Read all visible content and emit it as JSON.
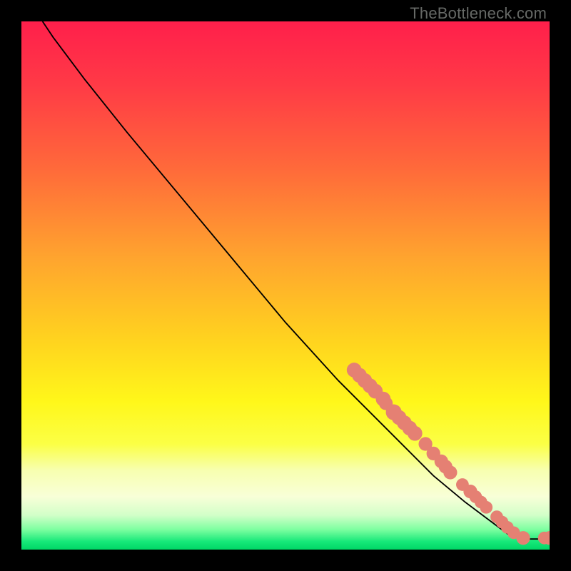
{
  "watermark": "TheBottleneck.com",
  "gradient": {
    "stops": [
      {
        "offset": 0.0,
        "color": "#ff1f4b"
      },
      {
        "offset": 0.12,
        "color": "#ff3a46"
      },
      {
        "offset": 0.28,
        "color": "#ff6a3a"
      },
      {
        "offset": 0.45,
        "color": "#ffa52e"
      },
      {
        "offset": 0.6,
        "color": "#ffd21f"
      },
      {
        "offset": 0.72,
        "color": "#fff71a"
      },
      {
        "offset": 0.8,
        "color": "#fbff45"
      },
      {
        "offset": 0.85,
        "color": "#f7ffb0"
      },
      {
        "offset": 0.9,
        "color": "#f8ffd8"
      },
      {
        "offset": 0.935,
        "color": "#d2ffc8"
      },
      {
        "offset": 0.962,
        "color": "#7dffa0"
      },
      {
        "offset": 0.985,
        "color": "#16e879"
      },
      {
        "offset": 1.0,
        "color": "#00d666"
      }
    ]
  },
  "chart_data": {
    "type": "line",
    "title": "",
    "xlabel": "",
    "ylabel": "",
    "xlim": [
      0,
      100
    ],
    "ylim": [
      0,
      100
    ],
    "series": [
      {
        "name": "curve",
        "points": [
          {
            "x": 4,
            "y": 100
          },
          {
            "x": 6,
            "y": 97
          },
          {
            "x": 9,
            "y": 93
          },
          {
            "x": 12,
            "y": 89
          },
          {
            "x": 20,
            "y": 79
          },
          {
            "x": 30,
            "y": 67
          },
          {
            "x": 40,
            "y": 55
          },
          {
            "x": 50,
            "y": 43
          },
          {
            "x": 60,
            "y": 32
          },
          {
            "x": 70,
            "y": 22
          },
          {
            "x": 78,
            "y": 14
          },
          {
            "x": 84,
            "y": 9
          },
          {
            "x": 88,
            "y": 6
          },
          {
            "x": 92,
            "y": 3
          },
          {
            "x": 95,
            "y": 2
          },
          {
            "x": 100,
            "y": 2
          }
        ]
      }
    ],
    "markers": [
      {
        "x": 63,
        "y": 34,
        "r": 1.4
      },
      {
        "x": 64,
        "y": 33,
        "r": 1.4
      },
      {
        "x": 65,
        "y": 32,
        "r": 1.4
      },
      {
        "x": 66,
        "y": 31,
        "r": 1.4
      },
      {
        "x": 67,
        "y": 30,
        "r": 1.4
      },
      {
        "x": 68.5,
        "y": 28.5,
        "r": 1.4
      },
      {
        "x": 69,
        "y": 27.7,
        "r": 1.3
      },
      {
        "x": 70.5,
        "y": 26,
        "r": 1.5
      },
      {
        "x": 71.5,
        "y": 25,
        "r": 1.4
      },
      {
        "x": 72.5,
        "y": 24,
        "r": 1.4
      },
      {
        "x": 73.5,
        "y": 23,
        "r": 1.4
      },
      {
        "x": 74.5,
        "y": 22,
        "r": 1.4
      },
      {
        "x": 76.5,
        "y": 20,
        "r": 1.3
      },
      {
        "x": 78,
        "y": 18.2,
        "r": 1.3
      },
      {
        "x": 79.5,
        "y": 16.7,
        "r": 1.3
      },
      {
        "x": 80.3,
        "y": 15.7,
        "r": 1.3
      },
      {
        "x": 81.2,
        "y": 14.6,
        "r": 1.3
      },
      {
        "x": 83.5,
        "y": 12.3,
        "r": 1.2
      },
      {
        "x": 85,
        "y": 11,
        "r": 1.3
      },
      {
        "x": 86,
        "y": 10,
        "r": 1.2
      },
      {
        "x": 87,
        "y": 9,
        "r": 1.2
      },
      {
        "x": 88,
        "y": 8,
        "r": 1.2
      },
      {
        "x": 90,
        "y": 6.2,
        "r": 1.2
      },
      {
        "x": 91,
        "y": 5.2,
        "r": 1.2
      },
      {
        "x": 92,
        "y": 4.2,
        "r": 1.2
      },
      {
        "x": 93.2,
        "y": 3.2,
        "r": 1.2
      },
      {
        "x": 95,
        "y": 2.2,
        "r": 1.3
      },
      {
        "x": 99,
        "y": 2.2,
        "r": 1.2
      },
      {
        "x": 100,
        "y": 2.2,
        "r": 1.3
      }
    ],
    "marker_color": "#e58073",
    "line_color": "#000000"
  }
}
